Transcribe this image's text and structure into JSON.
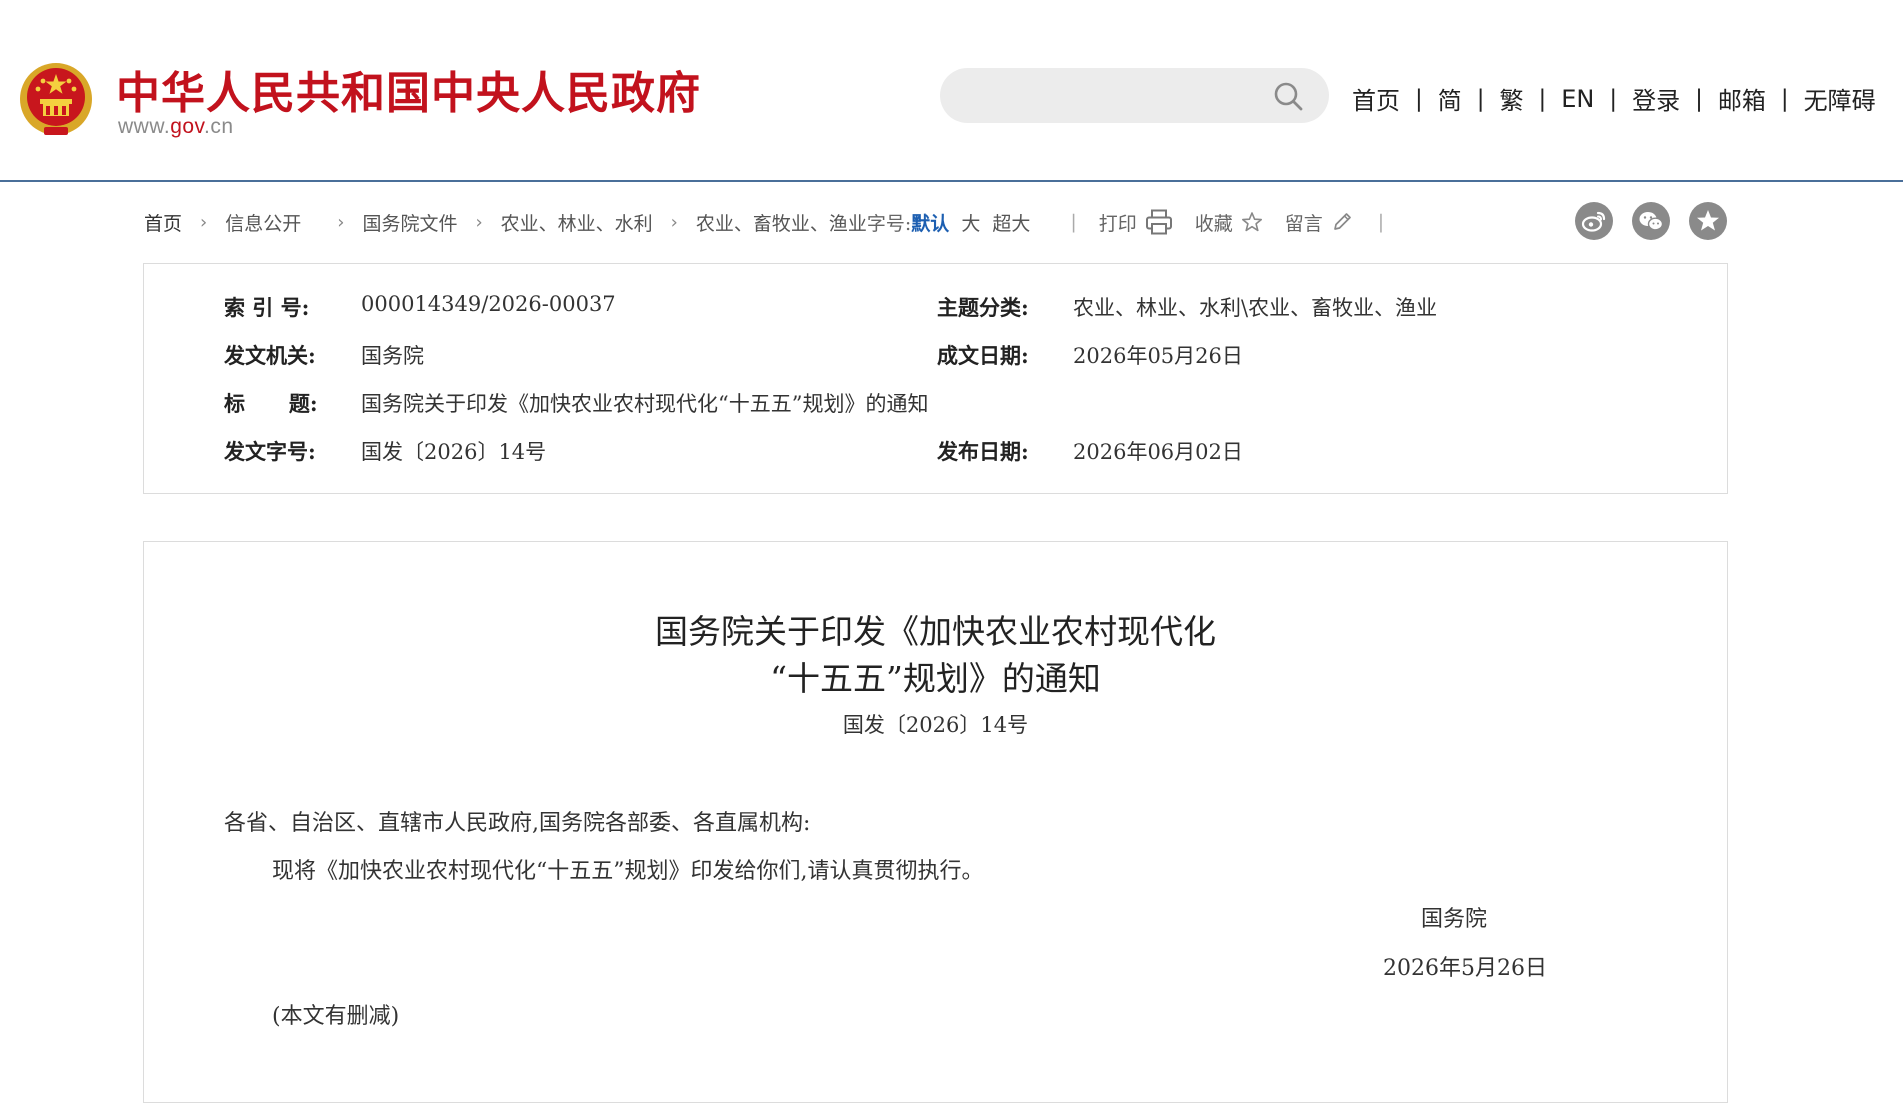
{
  "header": {
    "site_title": "中华人民共和国中央人民政府",
    "site_domain_prefix": "www.",
    "site_domain_mid": "gov",
    "site_domain_suffix": ".cn",
    "search_placeholder": "",
    "nav": [
      "首页",
      "简",
      "繁",
      "EN",
      "登录",
      "邮箱",
      "无障碍"
    ],
    "colors": {
      "brand_red": "#c2121d",
      "divider": "#4a6f99"
    }
  },
  "breadcrumb": {
    "items": [
      "首页",
      "信息公开",
      "国务院文件",
      "农业、林业、水利",
      "农业、畜牧业、渔业"
    ],
    "font_label": "字号:",
    "font_options": [
      "默认",
      "大",
      "超大"
    ],
    "tools": {
      "print": "打印",
      "favorite": "收藏",
      "comment": "留言"
    },
    "share_icons": [
      "weibo-icon",
      "wechat-icon",
      "favorite-star-icon"
    ]
  },
  "meta": {
    "index_label": "索 引 号:",
    "index_value": "000014349/2026-00037",
    "topic_label": "主题分类:",
    "topic_value": "农业、林业、水利\\农业、畜牧业、渔业",
    "issuer_label": "发文机关:",
    "issuer_value": "国务院",
    "written_label": "成文日期:",
    "written_value": "2026年05月26日",
    "title_label": "标      题:",
    "title_value": "国务院关于印发《加快农业农村现代化“十五五”规划》的通知",
    "docno_label": "发文字号:",
    "docno_value": "国发〔2026〕14号",
    "published_label": "发布日期:",
    "published_value": "2026年06月02日"
  },
  "document": {
    "title_line1": "国务院关于印发《加快农业农村现代化",
    "title_line2": "“十五五”规划》的通知",
    "number": "国发〔2026〕14号",
    "salutation": "各省、自治区、直辖市人民政府,国务院各部委、各直属机构:",
    "body": "现将《加快农业农村现代化“十五五”规划》印发给你们,请认真贯彻执行。",
    "signer": "国务院",
    "date": "2026年5月26日",
    "note": "(本文有删减)"
  }
}
